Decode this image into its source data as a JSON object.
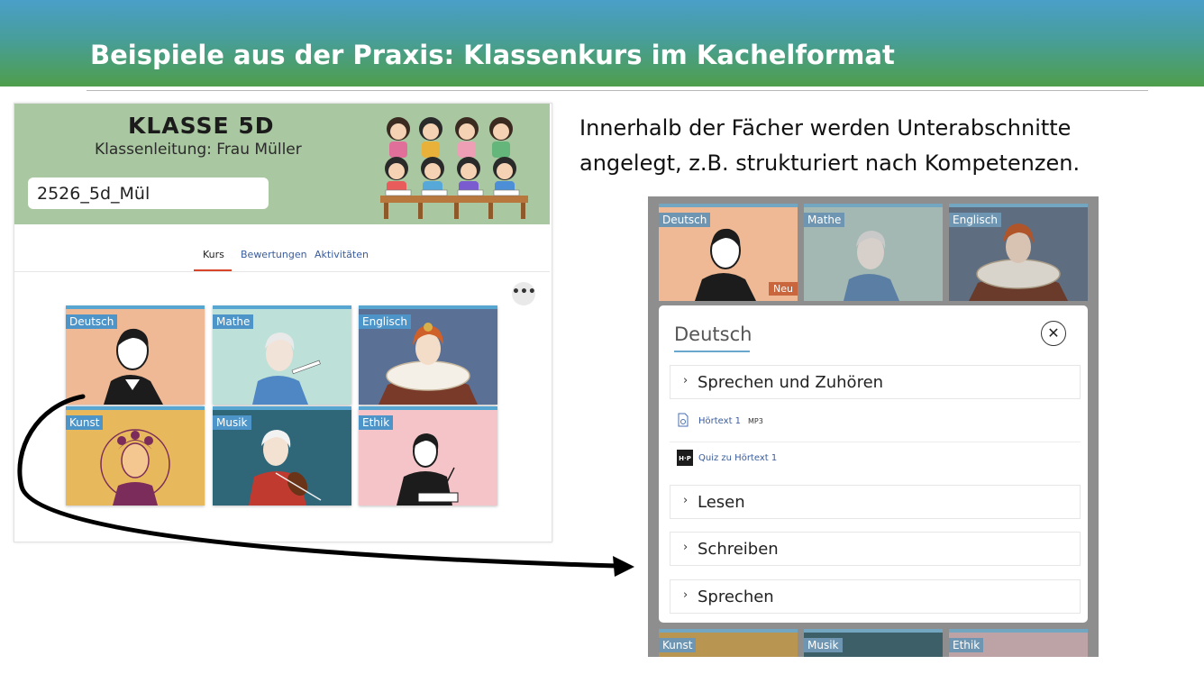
{
  "slide": {
    "title": "Beispiele aus der Praxis: Klassenkurs im Kachelformat",
    "description": "Innerhalb der Fächer werden Unterabschnitte angelegt, z.B. strukturiert nach Kompetenzen."
  },
  "course": {
    "name": "KLASSE 5D",
    "subtitle": "Klassenleitung: Frau Müller",
    "code": "2526_5d_Mül",
    "tabs": [
      {
        "label": "Kurs",
        "active": true
      },
      {
        "label": "Bewertungen",
        "active": false
      },
      {
        "label": "Aktivitäten",
        "active": false
      }
    ],
    "more_icon": "more-dots-icon",
    "tiles": [
      {
        "label": "Deutsch",
        "color": "#efb995",
        "figure": "goethe-portrait-icon"
      },
      {
        "label": "Mathe",
        "color": "#bde0d9",
        "figure": "mathematician-portrait-icon"
      },
      {
        "label": "Englisch",
        "color": "#5b7095",
        "figure": "queen-elizabeth-portrait-icon"
      },
      {
        "label": "Kunst",
        "color": "#e8b85c",
        "figure": "frida-kahlo-portrait-icon"
      },
      {
        "label": "Musik",
        "color": "#2f6778",
        "figure": "violinist-portrait-icon"
      },
      {
        "label": "Ethik",
        "color": "#f4c4c8",
        "figure": "writing-philosopher-icon"
      }
    ]
  },
  "detail": {
    "top_tiles": [
      {
        "label": "Deutsch",
        "color": "#efb995",
        "badge": "Neu"
      },
      {
        "label": "Mathe",
        "color": "#a4b8b3",
        "badge": ""
      },
      {
        "label": "Englisch",
        "color": "#5e6d80",
        "badge": ""
      }
    ],
    "bottom_tiles": [
      {
        "label": "Kunst",
        "color": "#b89652"
      },
      {
        "label": "Musik",
        "color": "#3d5f67"
      },
      {
        "label": "Ethik",
        "color": "#bda3a5"
      }
    ],
    "panel": {
      "title": "Deutsch",
      "close_icon": "close-icon",
      "sections": [
        {
          "label": "Sprechen und Zuhören"
        },
        {
          "label": "Lesen"
        },
        {
          "label": "Schreiben"
        },
        {
          "label": "Sprechen"
        }
      ],
      "activities": [
        {
          "name": "Hörtext 1",
          "type": "MP3",
          "icon": "audio-file-icon"
        },
        {
          "name": "Quiz zu Hörtext 1",
          "type": "",
          "icon": "h5p-icon"
        }
      ]
    }
  },
  "colors": {
    "header_gradient_top": "#4a9fc9",
    "header_gradient_bottom": "#4f9e4c",
    "banner": "#a9c7a0",
    "tile_label": "#4d94c8",
    "active_tab_underline": "#d9452b"
  }
}
